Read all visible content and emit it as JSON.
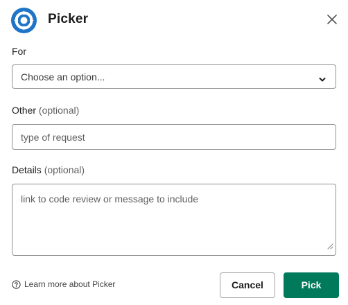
{
  "modal": {
    "title": "Picker",
    "logo_icon": "app-logo-icon",
    "close_icon": "close-icon"
  },
  "fields": {
    "for": {
      "label": "For",
      "selected": "Choose an option..."
    },
    "other": {
      "label": "Other",
      "optional": "(optional)",
      "placeholder": "type of request"
    },
    "details": {
      "label": "Details",
      "optional": "(optional)",
      "placeholder": "link to code review or message to include"
    }
  },
  "footer": {
    "learn_more": "Learn more about Picker",
    "cancel_label": "Cancel",
    "submit_label": "Pick"
  },
  "colors": {
    "primary": "#007a5a",
    "logo": "#1f74c8"
  }
}
